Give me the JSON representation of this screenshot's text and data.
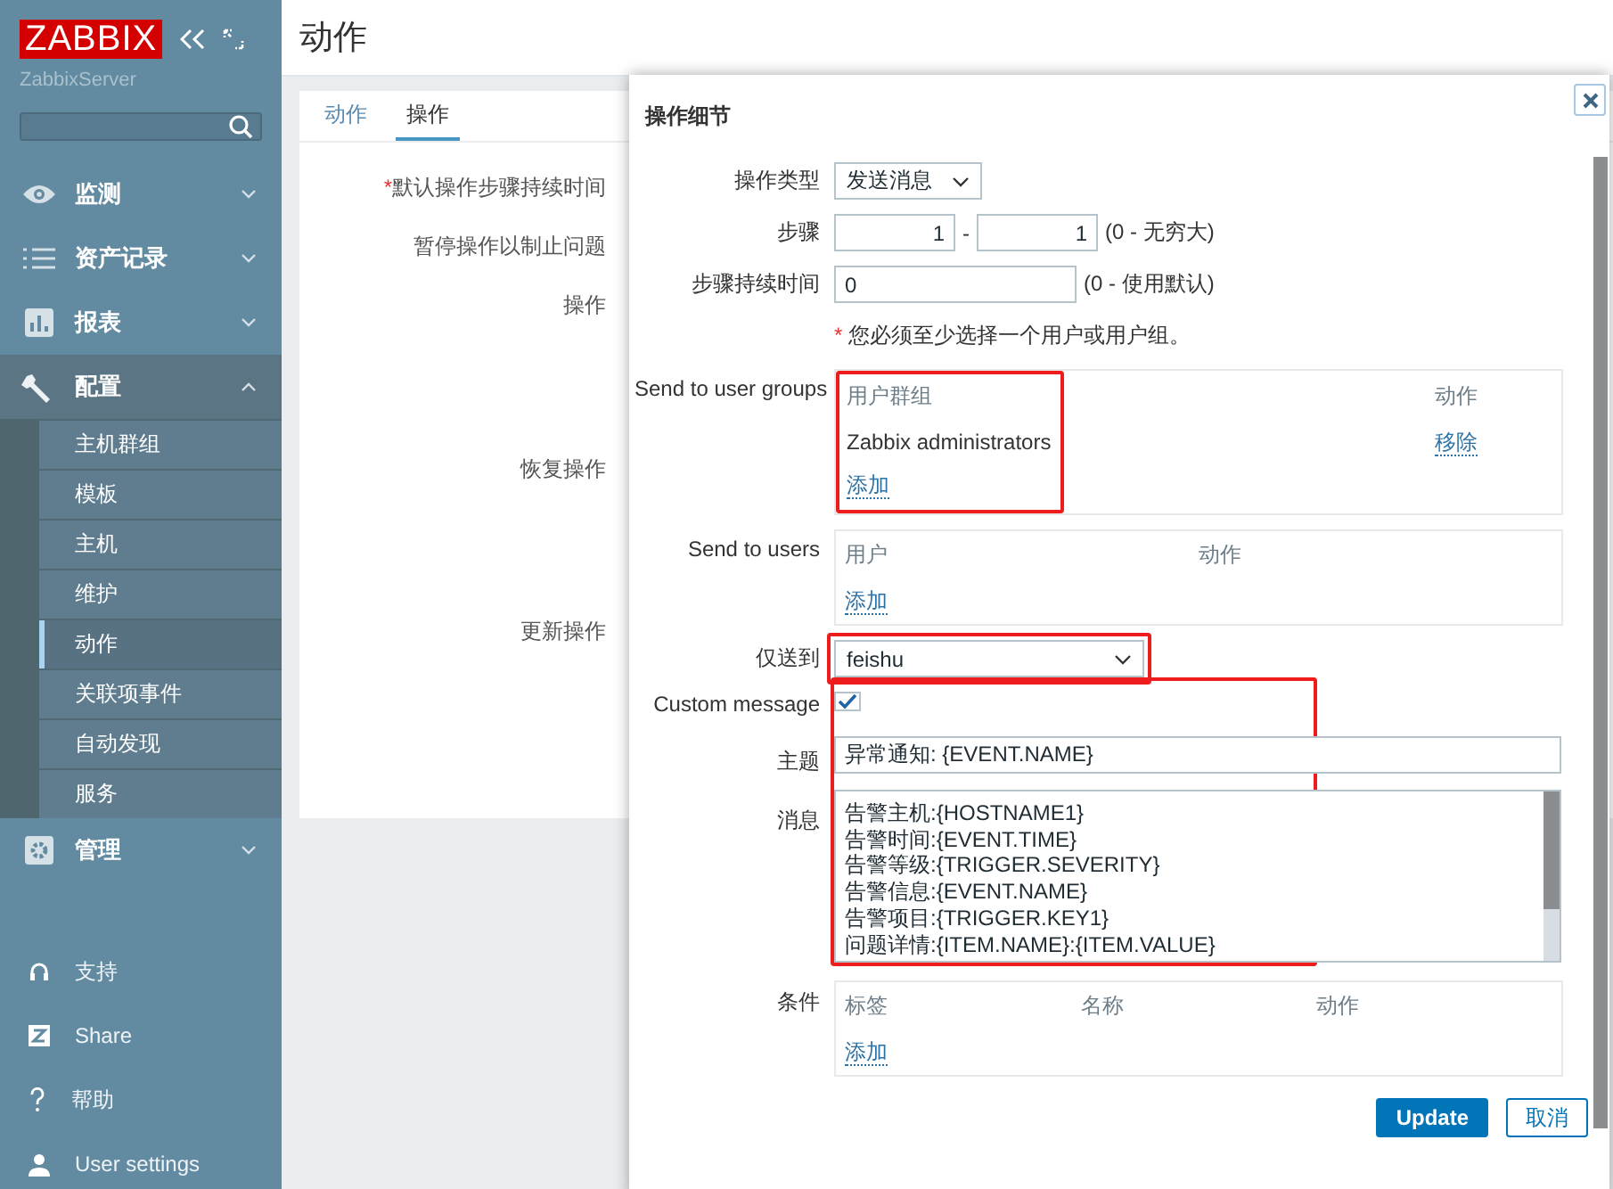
{
  "sidebar": {
    "logo": "ZABBIX",
    "server_name": "ZabbixServer",
    "menu": [
      {
        "label": "监测",
        "expanded": false
      },
      {
        "label": "资产记录",
        "expanded": false
      },
      {
        "label": "报表",
        "expanded": false
      },
      {
        "label": "配置",
        "expanded": true,
        "children": [
          {
            "label": "主机群组",
            "selected": false
          },
          {
            "label": "模板",
            "selected": false
          },
          {
            "label": "主机",
            "selected": false
          },
          {
            "label": "维护",
            "selected": false
          },
          {
            "label": "动作",
            "selected": true
          },
          {
            "label": "关联项事件",
            "selected": false
          },
          {
            "label": "自动发现",
            "selected": false
          },
          {
            "label": "服务",
            "selected": false
          }
        ]
      },
      {
        "label": "管理",
        "expanded": false
      }
    ],
    "bottom_links": [
      "支持",
      "Share",
      "帮助",
      "User settings"
    ]
  },
  "page": {
    "title": "动作",
    "tabs": [
      {
        "label": "动作",
        "selected": false
      },
      {
        "label": "操作",
        "selected": true
      }
    ],
    "form_rows": [
      {
        "label": "默认操作步骤持续时间",
        "mark": "*"
      },
      {
        "label": "暂停操作以制止问题"
      },
      {
        "label": "操作"
      },
      {
        "label": "恢复操作"
      },
      {
        "label": "更新操作"
      }
    ]
  },
  "modal": {
    "title": "操作细节",
    "operation_type": {
      "label": "操作类型",
      "value": "发送消息"
    },
    "steps": {
      "label": "步骤",
      "from": "1",
      "separator": "-",
      "to": "1",
      "hint": "(0 - 无穷大)"
    },
    "step_duration": {
      "label": "步骤持续时间",
      "value": "0",
      "hint": "(0 - 使用默认)"
    },
    "warning": {
      "mark": "*",
      "text": "您必须至少选择一个用户或用户组。"
    },
    "user_groups": {
      "label": "Send to user groups",
      "columns": [
        "用户群组",
        "动作"
      ],
      "rows": [
        {
          "name": "Zabbix administrators",
          "action": "移除"
        }
      ],
      "add": "添加",
      "highlighted": true
    },
    "users": {
      "label": "Send to users",
      "columns": [
        "用户",
        "动作"
      ],
      "add": "添加",
      "highlighted": false
    },
    "send_only_to": {
      "label": "仅送到",
      "value": "feishu",
      "highlighted": true
    },
    "custom_message": {
      "label": "Custom message",
      "checked": true,
      "highlighted": true
    },
    "subject": {
      "label": "主题",
      "value": "异常通知: {EVENT.NAME}"
    },
    "message": {
      "label": "消息",
      "lines": [
        "告警主机:{HOSTNAME1}",
        "告警时间:{EVENT.TIME}",
        "告警等级:{TRIGGER.SEVERITY}",
        "告警信息:{EVENT.NAME}",
        "告警项目:{TRIGGER.KEY1}",
        "问题详情:{ITEM.NAME}:{ITEM.VALUE}"
      ]
    },
    "conditions": {
      "label": "条件",
      "columns": [
        "标签",
        "名称",
        "动作"
      ],
      "add": "添加"
    },
    "buttons": [
      {
        "label": "Update",
        "kind": "primary"
      },
      {
        "label": "取消",
        "kind": "secondary"
      }
    ]
  }
}
